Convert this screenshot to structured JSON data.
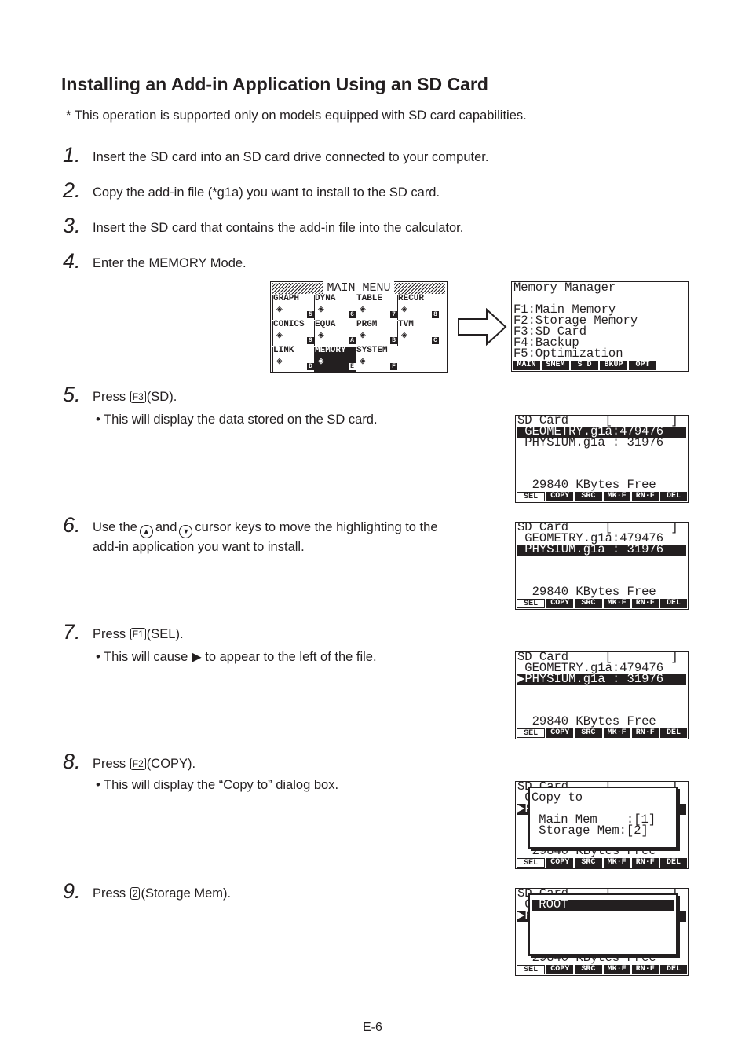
{
  "title": "Installing an Add-in Application Using an SD Card",
  "note": "* This operation is supported only on models equipped with SD card capabilities.",
  "steps": [
    {
      "n": "1.",
      "text": "Insert the SD card into an SD card drive connected to your computer."
    },
    {
      "n": "2.",
      "text": "Copy the add-in file (*g1a) you want to install to the SD card."
    },
    {
      "n": "3.",
      "text": "Insert the SD card that contains the add-in file into the calculator."
    },
    {
      "n": "4.",
      "text": "Enter the MEMORY Mode."
    },
    {
      "n": "5.",
      "pre": "Press",
      "key": "F3",
      "post": "(SD).",
      "bullet": "• This will display the data stored on the SD card."
    },
    {
      "n": "6.",
      "a": "Use the",
      "b": "and",
      "c": "cursor keys to move the highlighting to the",
      "d": "add-in application you want to install."
    },
    {
      "n": "7.",
      "pre": "Press",
      "key": "F1",
      "post": "(SEL).",
      "bullet_a": "• This will cause",
      "bullet_b": "to appear to the left of the file."
    },
    {
      "n": "8.",
      "pre": "Press",
      "key": "F2",
      "post": "(COPY).",
      "bullet": "• This will display the “Copy to” dialog box."
    },
    {
      "n": "9.",
      "pre": "Press",
      "key": "2",
      "post": "(Storage Mem)."
    }
  ],
  "main_menu": {
    "title": "MAIN MENU",
    "cells": [
      {
        "label": "GRAPH",
        "icon": "graph-icon",
        "letter": "5"
      },
      {
        "label": "DYNA",
        "icon": "dyna-icon",
        "letter": "6"
      },
      {
        "label": "TABLE",
        "icon": "table-icon",
        "letter": "7"
      },
      {
        "label": "RECUR",
        "icon": "recur-icon",
        "letter": "8"
      },
      {
        "label": "CONICS",
        "icon": "conics-icon",
        "letter": "9"
      },
      {
        "label": "EQUA",
        "icon": "equa-icon",
        "letter": "A"
      },
      {
        "label": "PRGM",
        "icon": "prgm-icon",
        "letter": "B"
      },
      {
        "label": "TVM",
        "icon": "tvm-icon",
        "letter": "C"
      },
      {
        "label": "LINK",
        "icon": "link-icon",
        "letter": "D"
      },
      {
        "label": "MEMORY",
        "icon": "memory-icon",
        "letter": "E"
      },
      {
        "label": "SYSTEM",
        "icon": "system-icon",
        "letter": "F"
      }
    ]
  },
  "memory_manager": {
    "title": "Memory Manager",
    "items": [
      "F1:Main Memory",
      "F2:Storage Memory",
      "F3:SD Card",
      "F4:Backup",
      "F5:Optimization"
    ],
    "fkeys": [
      "MAIN",
      "SMEM",
      "S D",
      "BKUP",
      "OPT"
    ]
  },
  "sd_screen": {
    "header": "SD Card     [        ]",
    "file1": " GEOMETRY.g1a:479476",
    "file2": " PHYSIUM.g1a : 31976",
    "file2_sel": "▶PHYSIUM.g1a : 31976",
    "free": "  29840 KBytes Free",
    "fkeys": [
      "SEL",
      "COPY",
      "SRC",
      "MK·F",
      "RN·F",
      "DEL"
    ]
  },
  "copy_dialog": {
    "title": "Copy to",
    "opt1": " Main Mem    :[1]",
    "opt2": " Storage Mem:[2]"
  },
  "folder_dialog": {
    "item": " ROOT"
  },
  "page_number": "E-6"
}
